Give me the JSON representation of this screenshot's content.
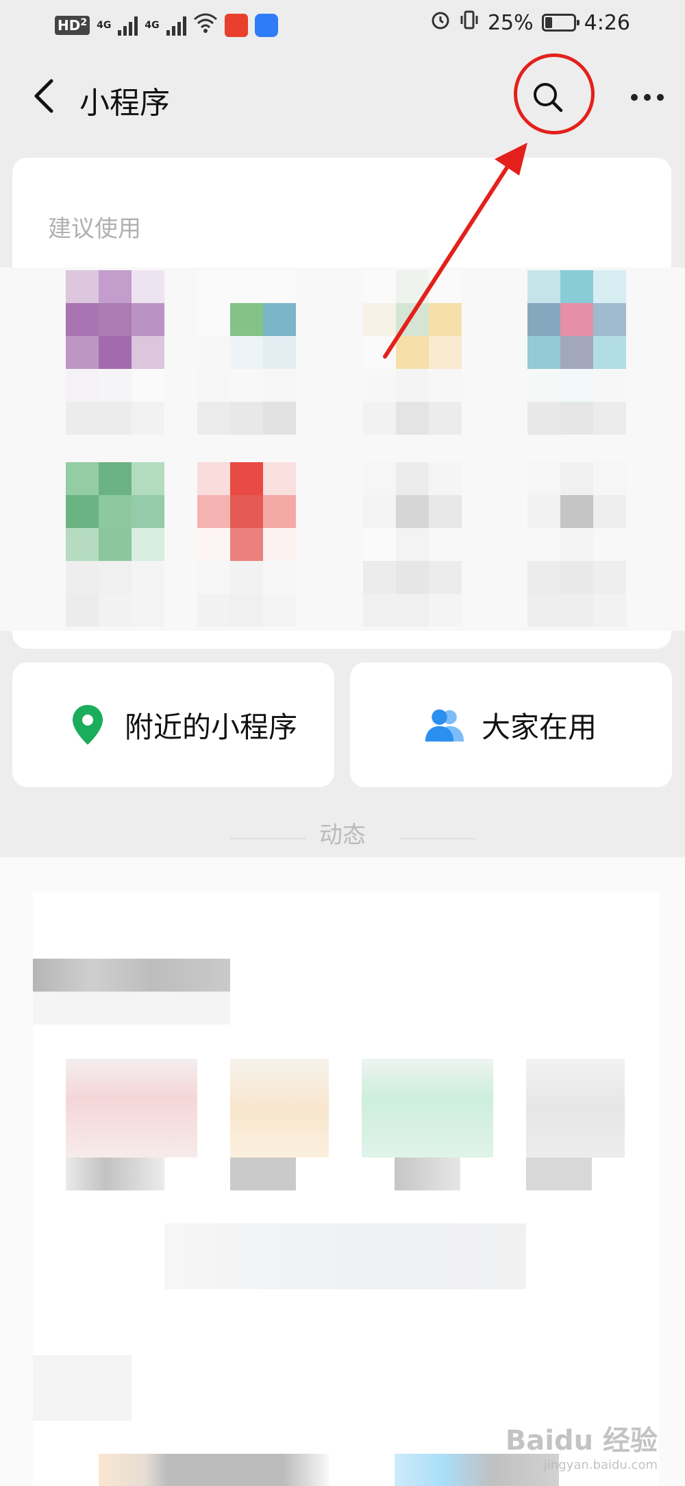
{
  "status_bar": {
    "hd_label": "HD",
    "hd_sub": "2",
    "net1": "4G",
    "net2": "4G",
    "battery_percent": "25%",
    "battery_level": 0.25,
    "time": "4:26"
  },
  "header": {
    "title": "小程序"
  },
  "recommended": {
    "label": "建议使用"
  },
  "quick_actions": {
    "nearby_label": "附近的小程序",
    "popular_label": "大家在用"
  },
  "feed": {
    "title": "动态"
  },
  "watermark": {
    "text": "Baidu 经验",
    "sub": "jingyan.baidu.com"
  },
  "colors": {
    "accent_green": "#1aad5b",
    "accent_blue": "#2b8ff0",
    "annotation_red": "#e3201b"
  }
}
